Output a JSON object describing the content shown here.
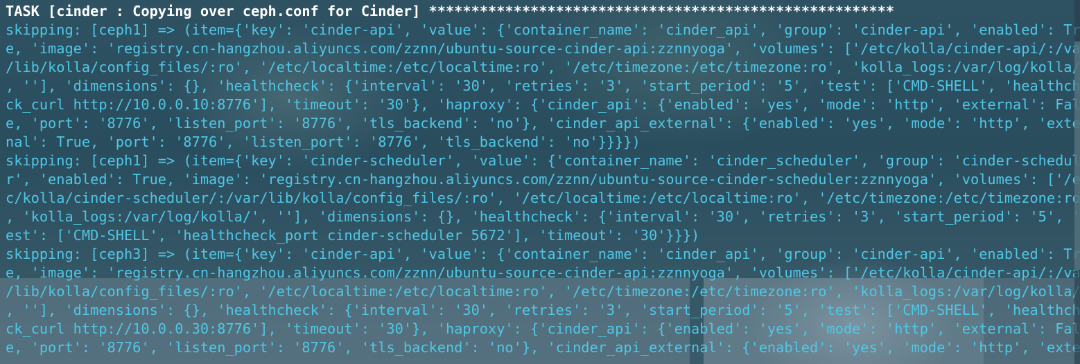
{
  "terminal": {
    "lines": [
      {
        "kind": "task",
        "text": "TASK [cinder : Copying over ceph.conf for Cinder] *******************************************************"
      },
      {
        "kind": "skip",
        "text": "skipping: [ceph1] => (item={'key': 'cinder-api', 'value': {'container_name': 'cinder_api', 'group': 'cinder-api', 'enabled': Tru"
      },
      {
        "kind": "skip",
        "text": "e, 'image': 'registry.cn-hangzhou.aliyuncs.com/zznn/ubuntu-source-cinder-api:zznnyoga', 'volumes': ['/etc/kolla/cinder-api/:/var"
      },
      {
        "kind": "skip",
        "text": "/lib/kolla/config_files/:ro', '/etc/localtime:/etc/localtime:ro', '/etc/timezone:/etc/timezone:ro', 'kolla_logs:/var/log/kolla/'"
      },
      {
        "kind": "skip",
        "text": ", ''], 'dimensions': {}, 'healthcheck': {'interval': '30', 'retries': '3', 'start_period': '5', 'test': ['CMD-SHELL', 'healthche"
      },
      {
        "kind": "skip",
        "text": "ck_curl http://10.0.0.10:8776'], 'timeout': '30'}, 'haproxy': {'cinder_api': {'enabled': 'yes', 'mode': 'http', 'external': Fals"
      },
      {
        "kind": "skip",
        "text": "e, 'port': '8776', 'listen_port': '8776', 'tls_backend': 'no'}, 'cinder_api_external': {'enabled': 'yes', 'mode': 'http', 'exter"
      },
      {
        "kind": "skip",
        "text": "nal': True, 'port': '8776', 'listen_port': '8776', 'tls_backend': 'no'}}}})"
      },
      {
        "kind": "skip",
        "text": "skipping: [ceph1] => (item={'key': 'cinder-scheduler', 'value': {'container_name': 'cinder_scheduler', 'group': 'cinder-schedule"
      },
      {
        "kind": "skip",
        "text": "r', 'enabled': True, 'image': 'registry.cn-hangzhou.aliyuncs.com/zznn/ubuntu-source-cinder-scheduler:zznnyoga', 'volumes': ['/et"
      },
      {
        "kind": "skip",
        "text": "c/kolla/cinder-scheduler/:/var/lib/kolla/config_files/:ro', '/etc/localtime:/etc/localtime:ro', '/etc/timezone:/etc/timezone:ro'"
      },
      {
        "kind": "skip",
        "text": ", 'kolla_logs:/var/log/kolla/', ''], 'dimensions': {}, 'healthcheck': {'interval': '30', 'retries': '3', 'start_period': '5', 't"
      },
      {
        "kind": "skip",
        "text": "est': ['CMD-SHELL', 'healthcheck_port cinder-scheduler 5672'], 'timeout': '30'}}})"
      },
      {
        "kind": "skip",
        "text": "skipping: [ceph3] => (item={'key': 'cinder-api', 'value': {'container_name': 'cinder_api', 'group': 'cinder-api', 'enabled': Tru"
      },
      {
        "kind": "skip",
        "text": "e, 'image': 'registry.cn-hangzhou.aliyuncs.com/zznn/ubuntu-source-cinder-api:zznnyoga', 'volumes': ['/etc/kolla/cinder-api/:/var"
      },
      {
        "kind": "skip",
        "text": "/lib/kolla/config_files/:ro', '/etc/localtime:/etc/localtime:ro', '/etc/timezone:/etc/timezone:ro', 'kolla_logs:/var/log/kolla/'"
      },
      {
        "kind": "skip",
        "text": ", ''], 'dimensions': {}, 'healthcheck': {'interval': '30', 'retries': '3', 'start_period': '5', 'test': ['CMD-SHELL', 'healthche"
      },
      {
        "kind": "skip",
        "text": "ck_curl http://10.0.0.30:8776'], 'timeout': '30'}, 'haproxy': {'cinder_api': {'enabled': 'yes', 'mode': 'http', 'external': Fals"
      },
      {
        "kind": "skip",
        "text": "e, 'port': '8776', 'listen_port': '8776', 'tls_backend': 'no'}, 'cinder_api_external': {'enabled': 'yes', 'mode': 'http', 'exter"
      }
    ]
  }
}
